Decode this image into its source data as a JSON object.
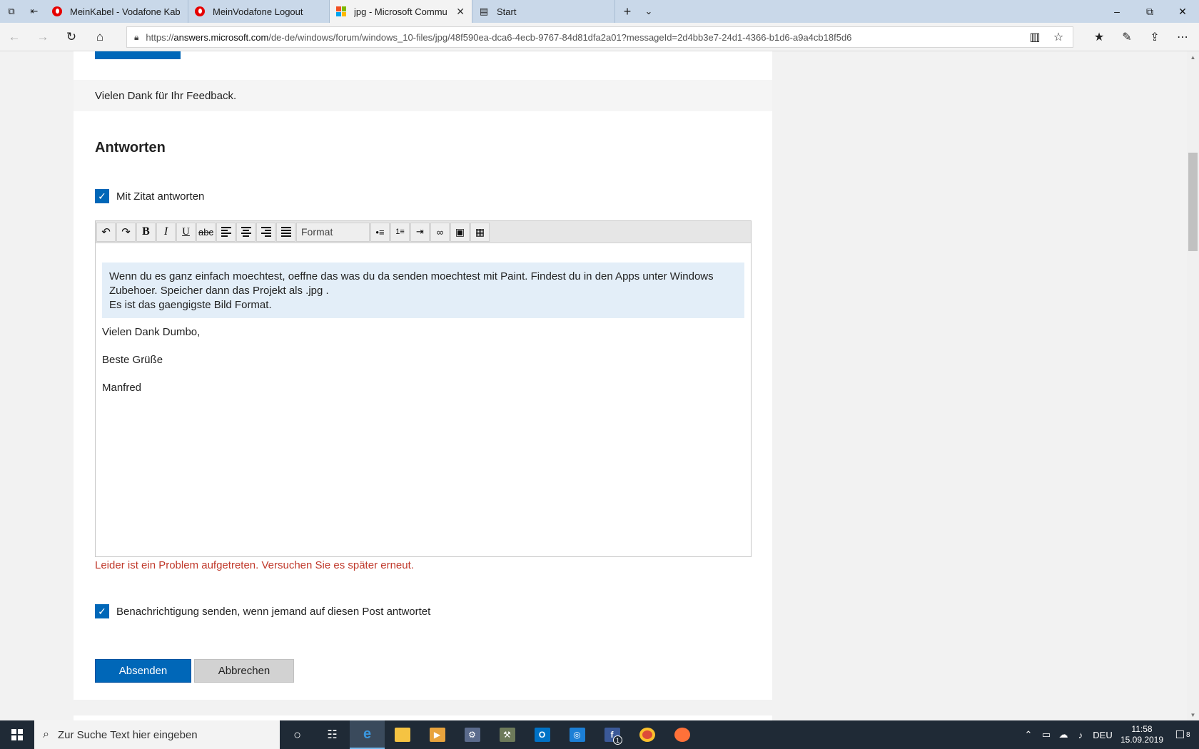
{
  "browser": {
    "tabs": [
      {
        "title": "MeinKabel - Vodafone Kabe",
        "icon": "vodafone-icon",
        "active": false
      },
      {
        "title": "MeinVodafone Logout",
        "icon": "vodafone-icon",
        "active": false
      },
      {
        "title": "jpg - Microsoft Commu",
        "icon": "microsoft-icon",
        "active": true
      },
      {
        "title": "Start",
        "icon": "start-page-icon",
        "active": false
      }
    ],
    "url_prefix": "https://",
    "url_domain": "answers.microsoft.com",
    "url_path": "/de-de/windows/forum/windows_10-files/jpg/48f590ea-dca6-4ecb-9767-84d81dfa2a01?messageId=2d4bb3e7-24d1-4366-b1d6-a9a4cb18f5d6"
  },
  "page": {
    "feedback_text": "Vielen Dank für Ihr Feedback.",
    "answer_heading": "Antworten",
    "quote_checkbox_label": "Mit Zitat antworten",
    "quote_checked": true,
    "editor": {
      "format_label": "Format",
      "quote_lines": [
        "Wenn du es ganz einfach moechtest, oeffne das was du da senden moechtest mit Paint. Findest du in den Apps unter Windows",
        "Zubehoer. Speicher dann das Projekt als .jpg .",
        "Es ist das gaengigste Bild Format."
      ],
      "body_lines": [
        "Vielen Dank Dumbo,",
        "Beste Grüße",
        "Manfred"
      ]
    },
    "error_message": "Leider ist ein Problem aufgetreten. Versuchen Sie es später erneut.",
    "notify_checkbox_label": "Benachrichtigung senden, wenn jemand auf diesen Post antwortet",
    "notify_checked": true,
    "submit_label": "Absenden",
    "cancel_label": "Abbrechen"
  },
  "taskbar": {
    "search_placeholder": "Zur Suche Text hier eingeben",
    "language": "DEU",
    "time": "11:58",
    "date": "15.09.2019",
    "facebook_badge": "1",
    "notification_count": "8"
  },
  "colors": {
    "accent": "#0067b8",
    "error": "#c0392b",
    "quote_bg": "#e3eef8",
    "tabbar_bg": "#c9d8e9"
  }
}
